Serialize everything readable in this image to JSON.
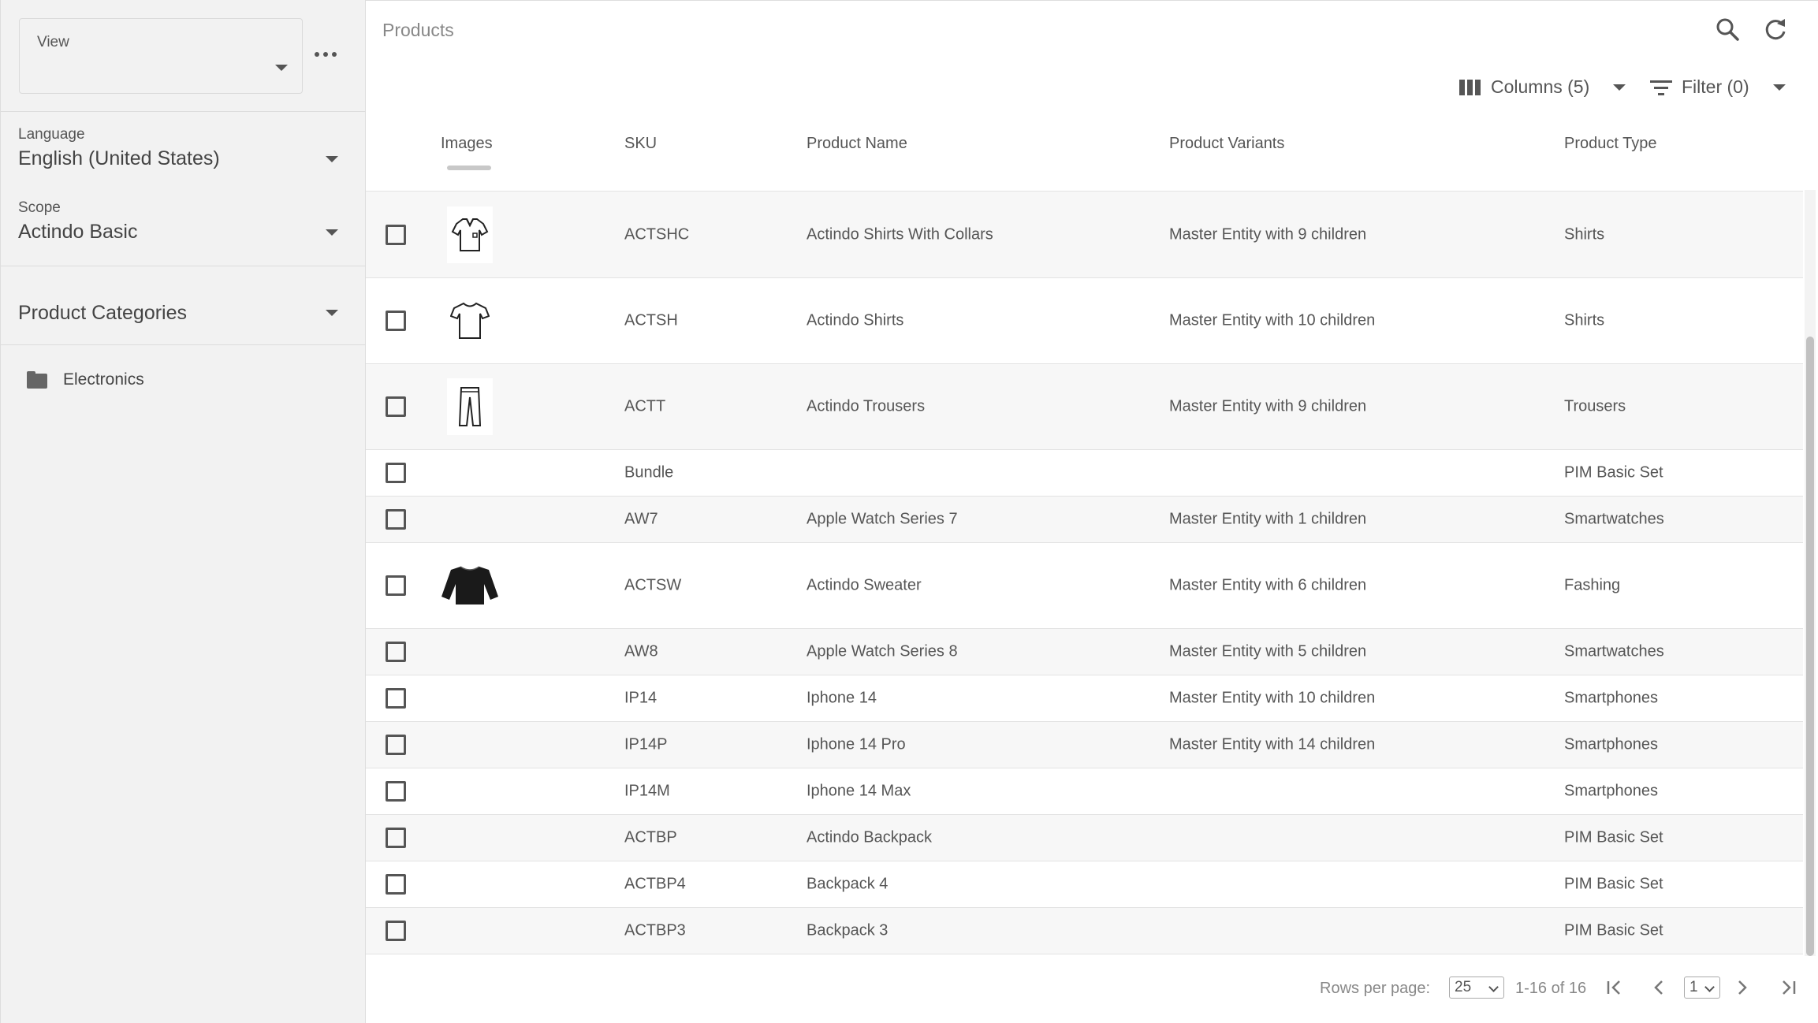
{
  "sidebar": {
    "view": {
      "label": "View",
      "value": ""
    },
    "language": {
      "label": "Language",
      "value": "English (United States)"
    },
    "scope": {
      "label": "Scope",
      "value": "Actindo Basic"
    },
    "categories": {
      "title": "Product Categories",
      "items": [
        {
          "label": "Electronics",
          "icon": "folder-icon"
        }
      ]
    }
  },
  "header": {
    "title": "Products",
    "columns_label": "Columns (5)",
    "filter_label": "Filter (0)"
  },
  "table": {
    "columns": [
      "Images",
      "SKU",
      "Product Name",
      "Product Variants",
      "Product Type"
    ],
    "rows": [
      {
        "image": "polo-shirt-icon",
        "sku": "ACTSHC",
        "name": "Actindo Shirts With Collars",
        "variants": "Master Entity with 9 children",
        "type": "Shirts"
      },
      {
        "image": "tshirt-icon",
        "sku": "ACTSH",
        "name": "Actindo Shirts",
        "variants": "Master Entity with 10 children",
        "type": "Shirts"
      },
      {
        "image": "trousers-icon",
        "sku": "ACTT",
        "name": "Actindo Trousers",
        "variants": "Master Entity with 9 children",
        "type": "Trousers"
      },
      {
        "image": "",
        "sku": "Bundle",
        "name": "",
        "variants": "",
        "type": "PIM Basic Set"
      },
      {
        "image": "",
        "sku": "AW7",
        "name": "Apple Watch Series 7",
        "variants": "Master Entity with 1 children",
        "type": "Smartwatches"
      },
      {
        "image": "sweater-icon",
        "sku": "ACTSW",
        "name": "Actindo Sweater",
        "variants": "Master Entity with 6 children",
        "type": "Fashing"
      },
      {
        "image": "",
        "sku": "AW8",
        "name": "Apple Watch Series 8",
        "variants": "Master Entity with 5 children",
        "type": "Smartwatches"
      },
      {
        "image": "",
        "sku": "IP14",
        "name": "Iphone 14",
        "variants": "Master Entity with 10 children",
        "type": "Smartphones"
      },
      {
        "image": "",
        "sku": "IP14P",
        "name": "Iphone 14 Pro",
        "variants": "Master Entity with 14 children",
        "type": "Smartphones"
      },
      {
        "image": "",
        "sku": "IP14M",
        "name": "Iphone 14 Max",
        "variants": "",
        "type": "Smartphones"
      },
      {
        "image": "",
        "sku": "ACTBP",
        "name": "Actindo Backpack",
        "variants": "",
        "type": "PIM Basic Set"
      },
      {
        "image": "",
        "sku": "ACTBP4",
        "name": "Backpack 4",
        "variants": "",
        "type": "PIM Basic Set"
      },
      {
        "image": "",
        "sku": "ACTBP3",
        "name": "Backpack 3",
        "variants": "",
        "type": "PIM Basic Set"
      }
    ]
  },
  "pagination": {
    "rows_per_page_label": "Rows per page:",
    "rows_per_page": "25",
    "range": "1-16 of 16",
    "page": "1"
  }
}
